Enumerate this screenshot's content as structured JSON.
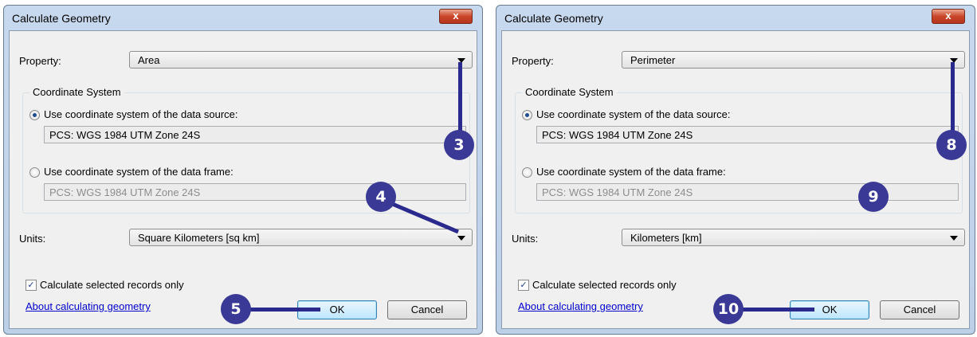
{
  "dialogs": [
    {
      "title": "Calculate Geometry",
      "close_label": "x",
      "property_label": "Property:",
      "property_value": "Area",
      "coordinate_system_label": "Coordinate System",
      "radio_source_label": "Use coordinate system of the data source:",
      "radio_source_checked": true,
      "source_cs_value": "PCS: WGS 1984 UTM Zone 24S",
      "radio_frame_label": "Use coordinate system of the data frame:",
      "radio_frame_checked": false,
      "frame_cs_value": "PCS: WGS 1984 UTM Zone 24S",
      "units_label": "Units:",
      "units_value": "Square Kilometers [sq km]",
      "selected_only_label": "Calculate selected records only",
      "selected_only_checked": true,
      "help_link": "About calculating geometry",
      "ok_label": "OK",
      "cancel_label": "Cancel",
      "callouts": {
        "property": "3",
        "units": "4",
        "ok": "5"
      }
    },
    {
      "title": "Calculate Geometry",
      "close_label": "x",
      "property_label": "Property:",
      "property_value": "Perimeter",
      "coordinate_system_label": "Coordinate System",
      "radio_source_label": "Use coordinate system of the data source:",
      "radio_source_checked": true,
      "source_cs_value": "PCS: WGS 1984 UTM Zone 24S",
      "radio_frame_label": "Use coordinate system of the data frame:",
      "radio_frame_checked": false,
      "frame_cs_value": "PCS: WGS 1984 UTM Zone 24S",
      "units_label": "Units:",
      "units_value": "Kilometers [km]",
      "selected_only_label": "Calculate selected records only",
      "selected_only_checked": true,
      "help_link": "About calculating geometry",
      "ok_label": "OK",
      "cancel_label": "Cancel",
      "callouts": {
        "property": "8",
        "units": "9",
        "ok": "10"
      }
    }
  ],
  "colors": {
    "callout": "#3a3a96",
    "titlebar": "#c7d9ee",
    "close_button": "#c9462a",
    "link": "#0000cc"
  }
}
